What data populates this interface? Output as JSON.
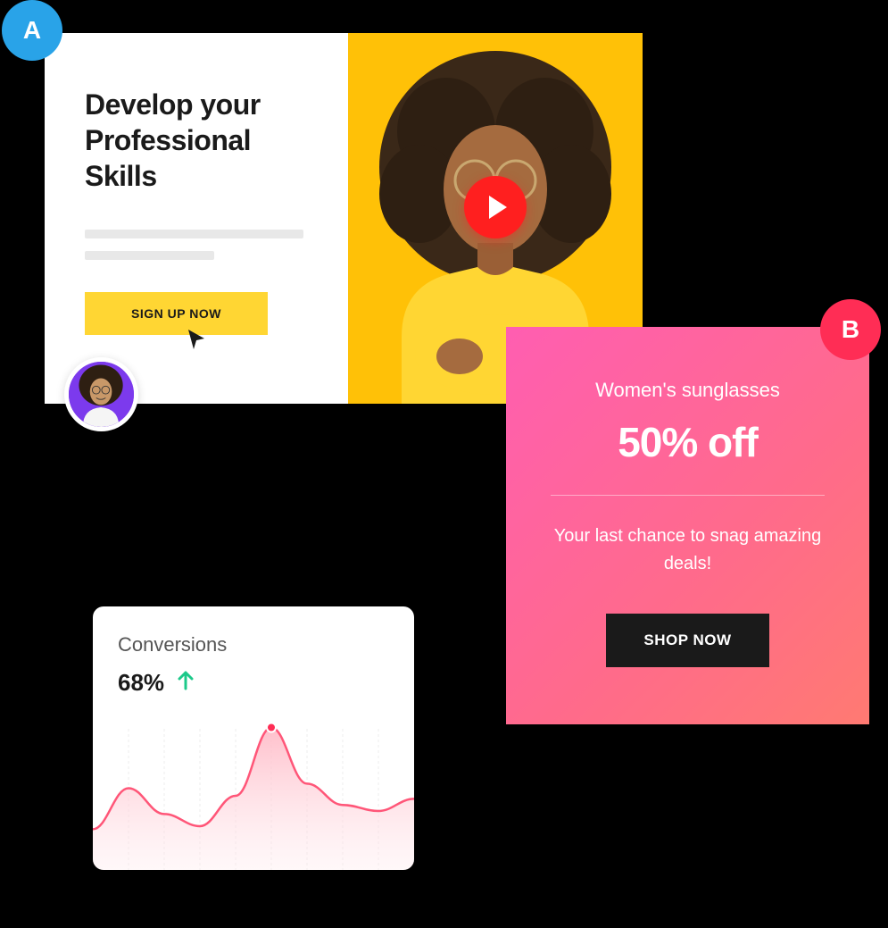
{
  "cardA": {
    "badge": "A",
    "title": "Develop your Professional Skills",
    "signup_label": "SIGN UP NOW"
  },
  "cardB": {
    "badge": "B",
    "subtitle": "Women's sunglasses",
    "title": "50% off",
    "description": "Your last chance to snag amazing deals!",
    "shop_label": "SHOP NOW"
  },
  "conversions": {
    "title": "Conversions",
    "value": "68%",
    "trend": "up"
  },
  "chart_data": {
    "type": "area",
    "title": "Conversions",
    "xlabel": "",
    "ylabel": "",
    "ylim": [
      0,
      100
    ],
    "x": [
      0,
      1,
      2,
      3,
      4,
      5,
      6,
      7,
      8,
      9
    ],
    "values": [
      28,
      55,
      38,
      30,
      50,
      95,
      58,
      44,
      40,
      48
    ],
    "peak_index": 5,
    "peak_value": 95
  },
  "colors": {
    "badge_a": "#29a3e8",
    "badge_b": "#ff2d55",
    "signup_btn": "#ffd633",
    "play_btn": "#ff1f1f",
    "promo_gradient_start": "#ff5eb1",
    "promo_gradient_end": "#ff7a72",
    "trend_up": "#1cc98a",
    "chart_stroke": "#ff5678",
    "chart_fill": "#ffd7dd"
  }
}
